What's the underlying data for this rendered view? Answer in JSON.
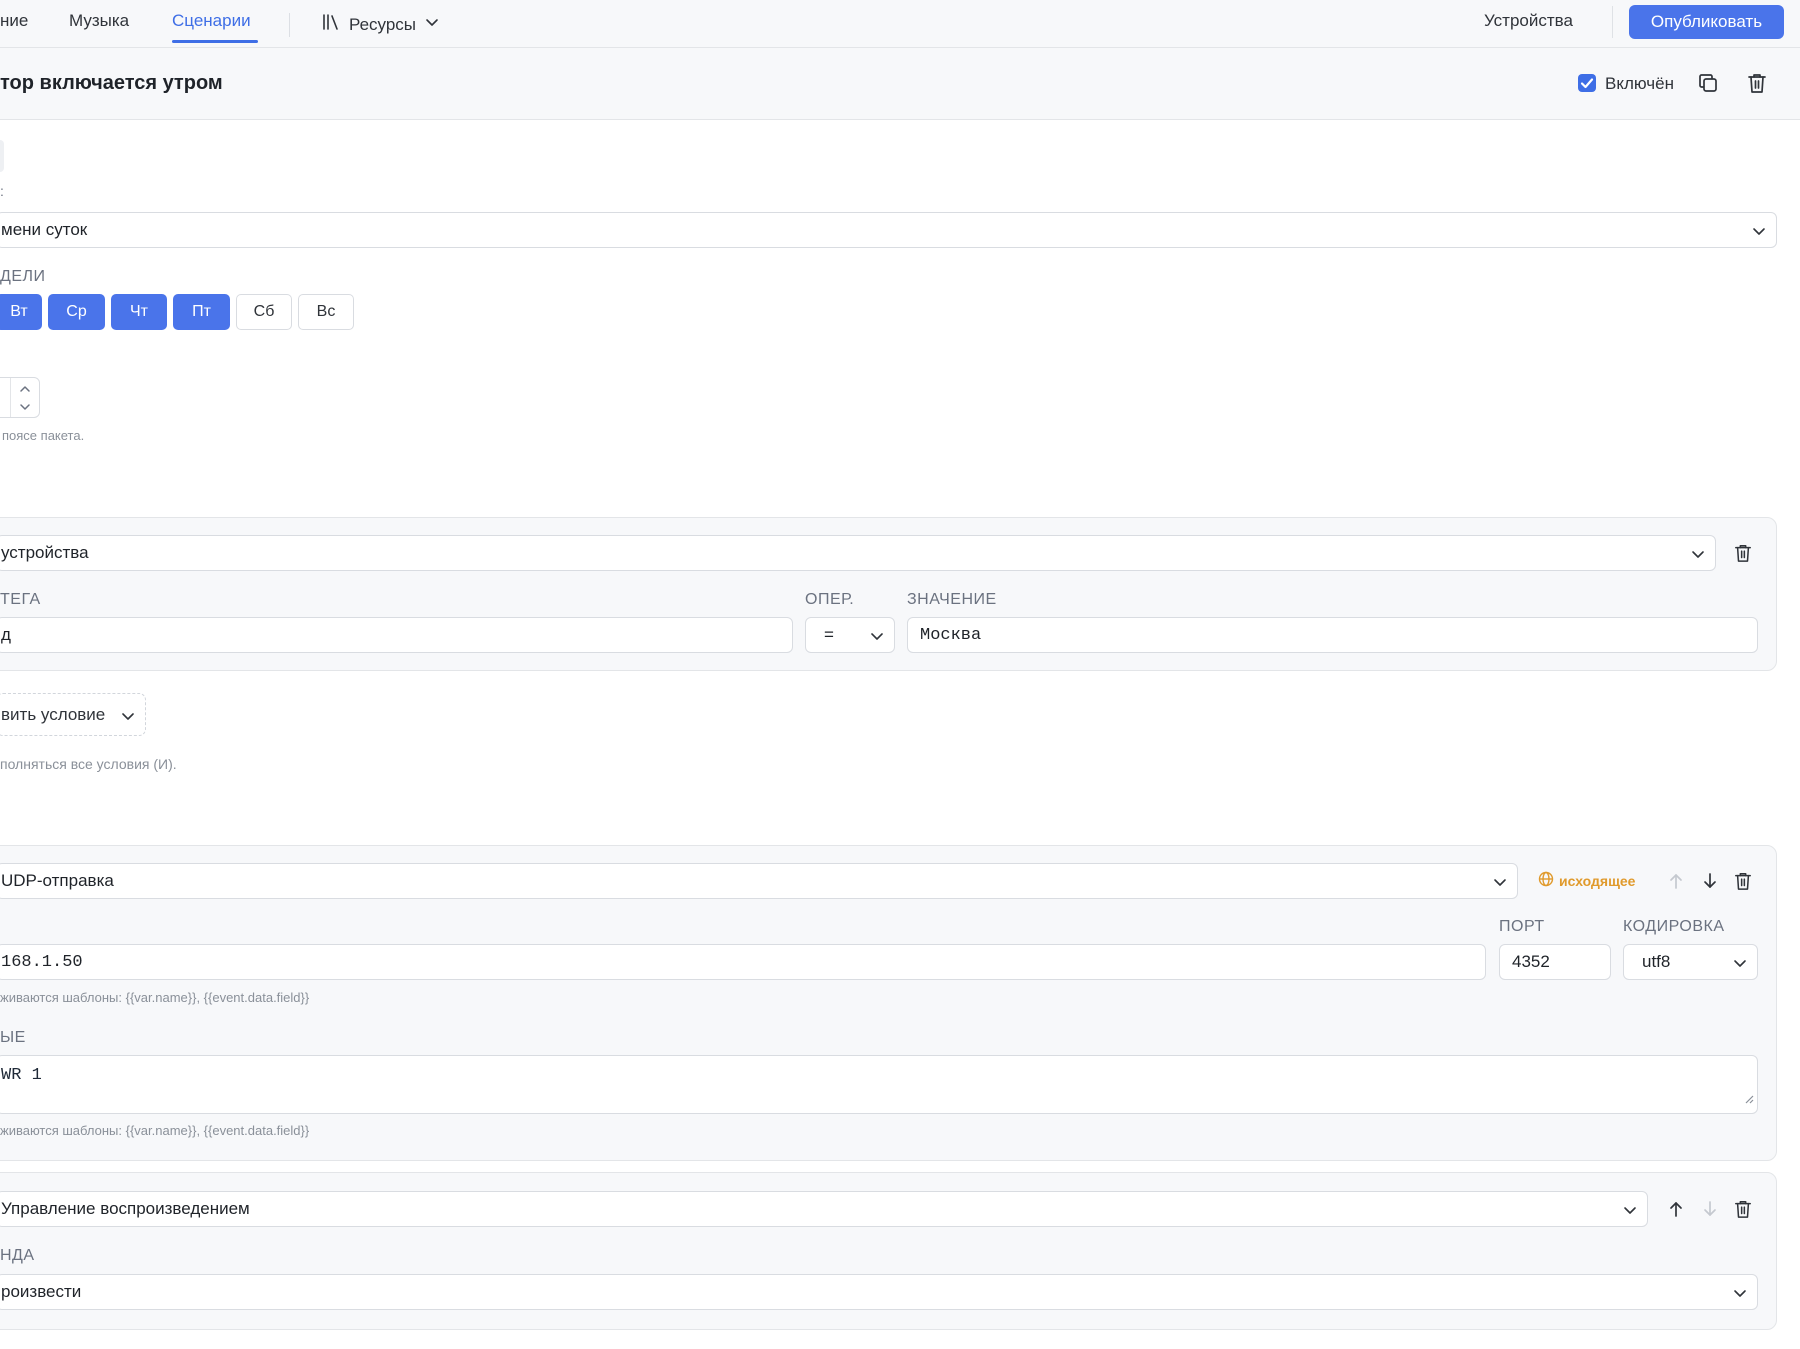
{
  "nav": {
    "items": [
      {
        "label": "ние"
      },
      {
        "label": "Музыка"
      },
      {
        "label": "Сценарии"
      },
      {
        "label": "Ресурсы"
      }
    ],
    "devices": "Устройства",
    "publish": "Опубликовать"
  },
  "scenario": {
    "title": "тор включается утром",
    "enabled_label": "Включён",
    "enabled": true
  },
  "trigger": {
    "colon_fragment": ":",
    "type_value": "мени суток",
    "days_label": "ДЕЛИ",
    "days": [
      {
        "label": "Вт",
        "active": true
      },
      {
        "label": "Ср",
        "active": true
      },
      {
        "label": "Чт",
        "active": true
      },
      {
        "label": "Пт",
        "active": true
      },
      {
        "label": "Сб",
        "active": false
      },
      {
        "label": "Вс",
        "active": false
      }
    ],
    "tz_hint": "поясе пакета."
  },
  "conditions": {
    "item": {
      "type_value": "устройства",
      "tag_label": "ТЕГА",
      "tag_value": "д",
      "op_label": "ОПЕР.",
      "op_value": "=",
      "value_label": "ЗНАЧЕНИЕ",
      "value": "Москва"
    },
    "add_label": "вить условие",
    "hint": "полняться все условия (И)."
  },
  "actions": [
    {
      "type_value": "UDP-отправка",
      "badge": "исходящее",
      "host_value": "168.1.50",
      "port_label": "ПОРТ",
      "port_value": "4352",
      "encoding_label": "КОДИРОВКА",
      "encoding_value": "utf8",
      "host_hint": "живаются шаблоны: {{var.name}}, {{event.data.field}}",
      "data_label": "ЫЕ",
      "data_value": "WR 1",
      "data_hint": "живаются шаблоны: {{var.name}}, {{event.data.field}}"
    },
    {
      "type_value": "Управление воспроизведением",
      "command_label": "НДА",
      "command_value": "роизвести"
    }
  ],
  "colors": {
    "accent": "#4a74ea",
    "badge": "#e09a2c"
  }
}
